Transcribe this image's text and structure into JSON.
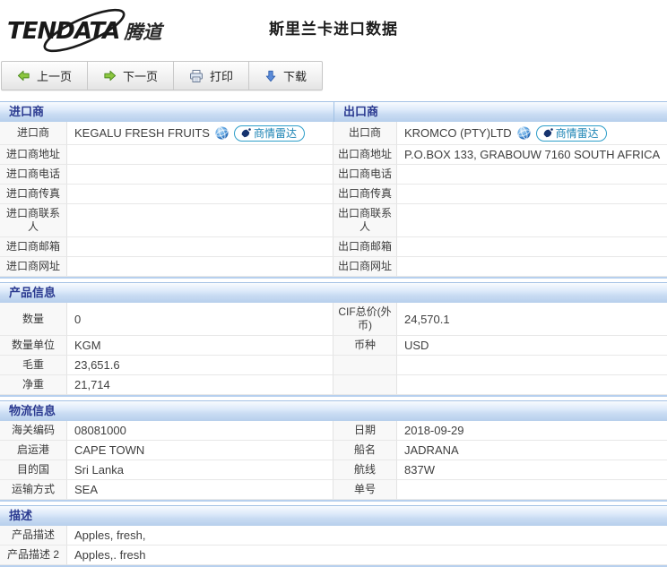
{
  "brand": {
    "name": "TENDATA",
    "cn": "腾道"
  },
  "page_title": "斯里兰卡进口数据",
  "toolbar": {
    "prev_label": "上一页",
    "next_label": "下一页",
    "print_label": "打印",
    "download_label": "下载"
  },
  "radar_button_label": "商情雷达",
  "company": {
    "importer_header": "进口商",
    "exporter_header": "出口商",
    "importer": {
      "name_label": "进口商",
      "name": "KEGALU FRESH FRUITS",
      "rows": [
        {
          "label": "进口商地址",
          "value": ""
        },
        {
          "label": "进口商电话",
          "value": ""
        },
        {
          "label": "进口商传真",
          "value": ""
        },
        {
          "label": "进口商联系人",
          "value": ""
        },
        {
          "label": "进口商邮箱",
          "value": ""
        },
        {
          "label": "进口商网址",
          "value": ""
        }
      ]
    },
    "exporter": {
      "name_label": "出口商",
      "name": "KROMCO (PTY)LTD",
      "rows": [
        {
          "label": "出口商地址",
          "value": "P.O.BOX 133, GRABOUW 7160 SOUTH AFRICA"
        },
        {
          "label": "出口商电话",
          "value": ""
        },
        {
          "label": "出口商传真",
          "value": ""
        },
        {
          "label": "出口商联系人",
          "value": ""
        },
        {
          "label": "出口商邮箱",
          "value": ""
        },
        {
          "label": "出口商网址",
          "value": ""
        }
      ]
    }
  },
  "product": {
    "header": "产品信息",
    "rows": [
      {
        "l1": "数量",
        "v1": "0",
        "l2": "CIF总价(外币)",
        "v2": "24,570.1"
      },
      {
        "l1": "数量单位",
        "v1": "KGM",
        "l2": "币种",
        "v2": "USD"
      },
      {
        "l1": "毛重",
        "v1": "23,651.6",
        "l2": "",
        "v2": ""
      },
      {
        "l1": "净重",
        "v1": "21,714",
        "l2": "",
        "v2": ""
      }
    ]
  },
  "logistics": {
    "header": "物流信息",
    "rows": [
      {
        "l1": "海关编码",
        "v1": "08081000",
        "l2": "日期",
        "v2": "2018-09-29"
      },
      {
        "l1": "启运港",
        "v1": "CAPE TOWN",
        "l2": "船名",
        "v2": "JADRANA"
      },
      {
        "l1": "目的国",
        "v1": "Sri Lanka",
        "l2": "航线",
        "v2": "837W"
      },
      {
        "l1": "运输方式",
        "v1": "SEA",
        "l2": "单号",
        "v2": ""
      }
    ]
  },
  "description": {
    "header": "描述",
    "rows": [
      {
        "label": "产品描述",
        "value": "Apples, fresh,"
      },
      {
        "label": "产品描述 2",
        "value": "Apples,. fresh"
      }
    ]
  },
  "colors": {
    "section_header_text": "#2b3a90",
    "section_header_gradient_bottom": "#b7cfec",
    "section_border": "#b7d0ee",
    "radar_accent": "#1d84b5",
    "radar_border": "#2e9ec9",
    "green_arrow": "#8cc63f",
    "blue_arrow": "#5b8bd8",
    "label_cell_bg": "#f8f8f8"
  }
}
